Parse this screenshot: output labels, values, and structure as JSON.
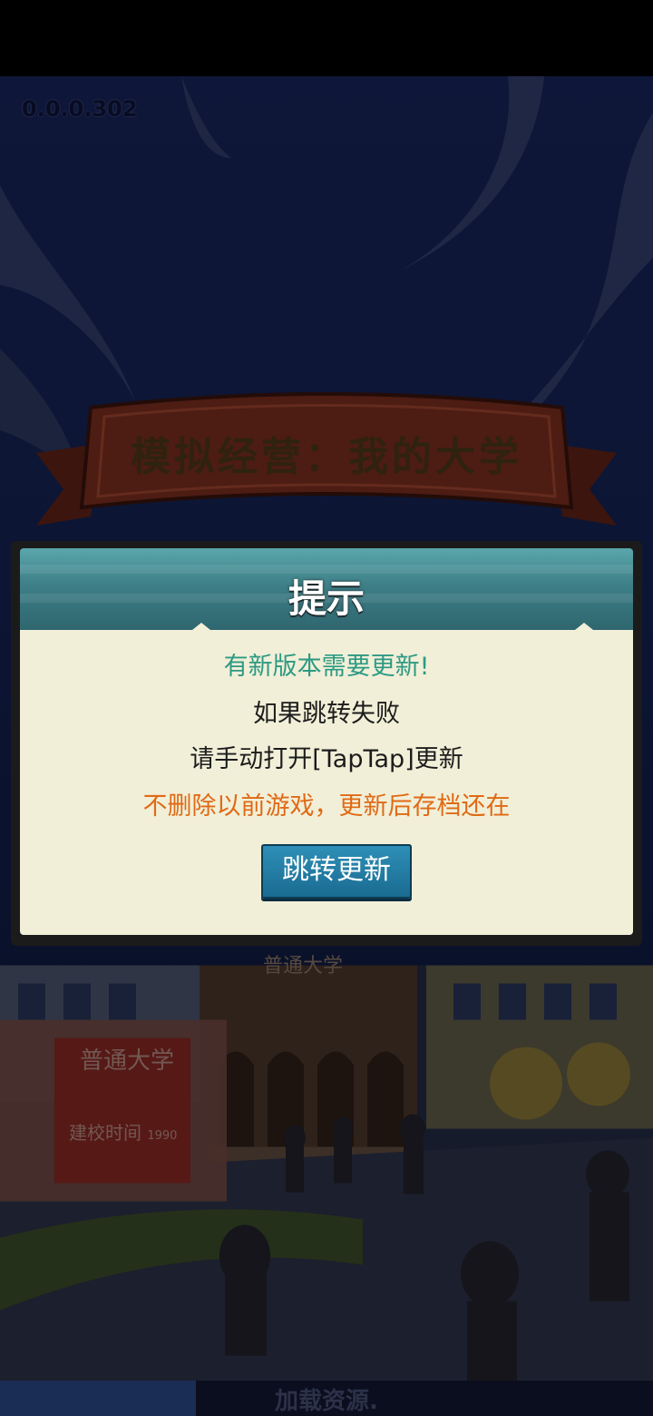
{
  "version": "0.0.0.302",
  "game_title": "模拟经营：我的大学",
  "dialog": {
    "title": "提示",
    "line1": "有新版本需要更新!",
    "line2": "如果跳转失败",
    "line3": "请手动打开[TapTap]更新",
    "line4": "不删除以前游戏，更新后存档还在",
    "button_label": "跳转更新"
  },
  "campus": {
    "building_sign": "普通大学",
    "gate_name": "普通大学",
    "gate_est_label": "建校时间",
    "gate_est_year": "1990"
  },
  "loading": {
    "text": "加载资源.",
    "progress": 0.3
  },
  "colors": {
    "dialog_header": "#3e7f87",
    "dialog_body": "#f1efd8",
    "highlight_green": "#2d9a83",
    "warning_orange": "#e06a15",
    "button_blue": "#1a6b92"
  }
}
